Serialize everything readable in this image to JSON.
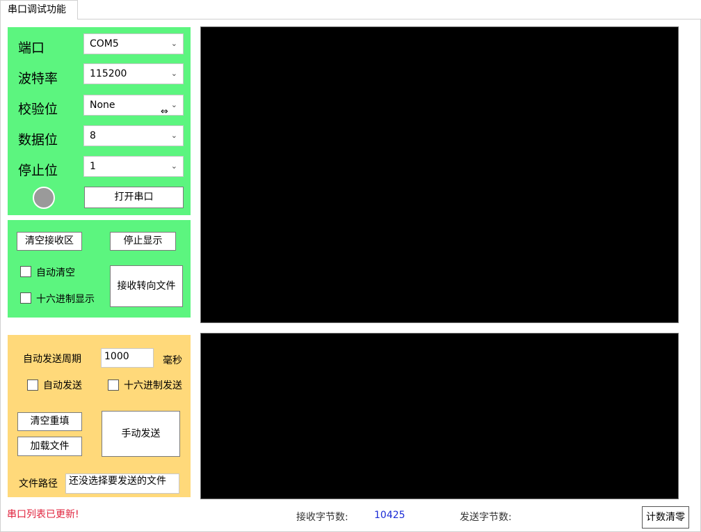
{
  "tab": {
    "label": "串口调试功能"
  },
  "serial": {
    "port_label": "端口",
    "port_value": "COM5",
    "baud_label": "波特率",
    "baud_value": "115200",
    "parity_label": "校验位",
    "parity_value": "None",
    "databits_label": "数据位",
    "databits_value": "8",
    "stopbits_label": "停止位",
    "stopbits_value": "1",
    "open_button": "打开串口"
  },
  "receive": {
    "clear_button": "清空接收区",
    "stop_display_button": "停止显示",
    "auto_clear_label": "自动清空",
    "hex_display_label": "十六进制显示",
    "redirect_button": "接收转向文件"
  },
  "send": {
    "period_label": "自动发送周期",
    "period_value": "1000",
    "period_unit": "毫秒",
    "auto_send_label": "自动发送",
    "hex_send_label": "十六进制发送",
    "clear_refill_button": "清空重填",
    "load_file_button": "加载文件",
    "manual_send_button": "手动发送",
    "file_path_label": "文件路径",
    "file_path_value": "还没选择要发送的文件"
  },
  "status": {
    "message": "串口列表已更新!",
    "message_color": "#e0223c",
    "rx_label": "接收字节数:",
    "rx_value": "10425",
    "rx_value_color": "#1a2bd6",
    "tx_label": "发送字节数:",
    "tx_value": "",
    "reset_button": "计数清零"
  },
  "icons": {
    "dropdown": "chevron-down-icon",
    "resize_cursor": "resize-horizontal-icon"
  }
}
